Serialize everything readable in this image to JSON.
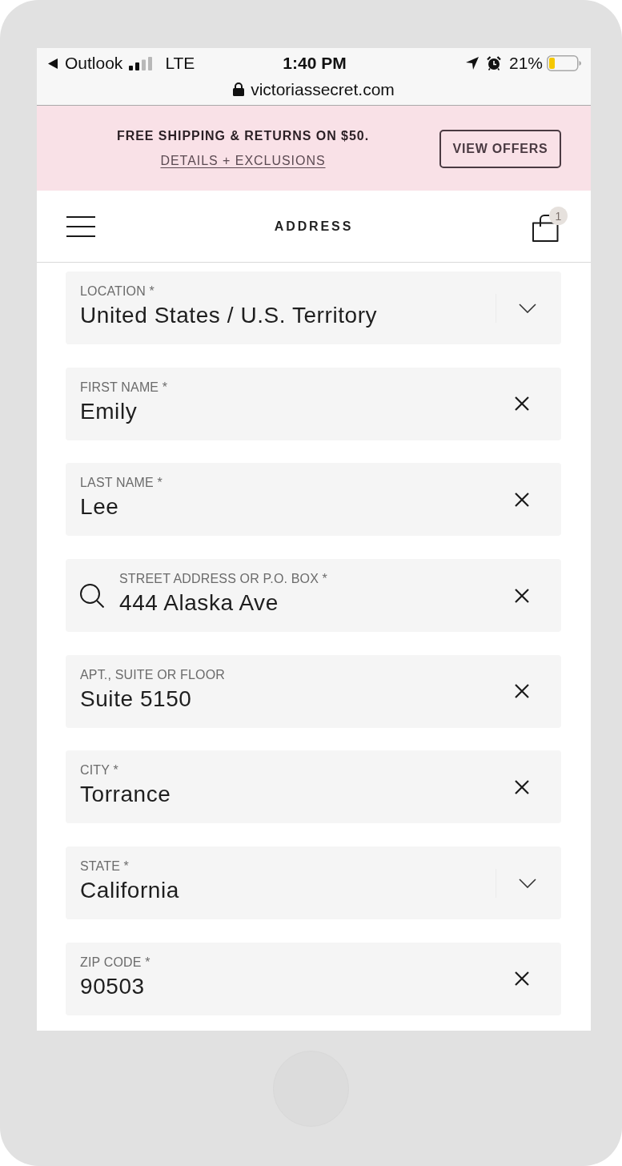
{
  "status_bar": {
    "back_app": "Outlook",
    "network": "LTE",
    "time": "1:40 PM",
    "battery": "21%"
  },
  "address_bar": {
    "url": "victoriassecret.com"
  },
  "promo_banner": {
    "headline": "FREE SHIPPING & RETURNS ON $50.",
    "link": "DETAILS + EXCLUSIONS",
    "button": "VIEW OFFERS"
  },
  "header": {
    "title": "ADDRESS",
    "cart_count": "1"
  },
  "fields": [
    {
      "kind": "select",
      "label": "LOCATION *",
      "value": "United States / U.S. Territory"
    },
    {
      "kind": "text",
      "label": "FIRST NAME *",
      "value": "Emily"
    },
    {
      "kind": "text",
      "label": "LAST NAME *",
      "value": "Lee"
    },
    {
      "kind": "search",
      "label": "STREET ADDRESS OR P.O. BOX *",
      "value": "444 Alaska Ave"
    },
    {
      "kind": "text",
      "label": "APT., SUITE OR FLOOR",
      "value": "Suite 5150"
    },
    {
      "kind": "text",
      "label": "CITY *",
      "value": "Torrance"
    },
    {
      "kind": "select",
      "label": "STATE *",
      "value": "California"
    },
    {
      "kind": "text",
      "label": "ZIP CODE *",
      "value": "90503"
    }
  ]
}
